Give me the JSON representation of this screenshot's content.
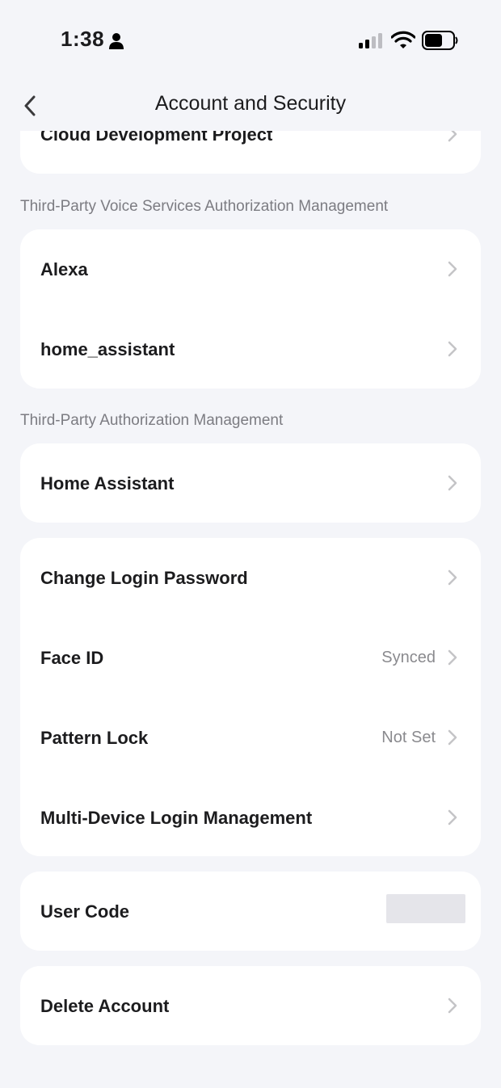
{
  "status_bar": {
    "time": "1:38",
    "icons": [
      "person-icon",
      "signal-icon",
      "wifi-icon",
      "battery-icon"
    ]
  },
  "header": {
    "title": "Account and Security",
    "back_icon": "chevron-left-icon"
  },
  "sections": {
    "top_card": {
      "items": [
        {
          "label": "Cloud Development Project"
        }
      ]
    },
    "voice_services": {
      "header": "Third-Party Voice Services Authorization Management",
      "items": [
        {
          "label": "Alexa"
        },
        {
          "label": "home_assistant"
        }
      ]
    },
    "third_party": {
      "header": "Third-Party Authorization Management",
      "items": [
        {
          "label": "Home Assistant"
        }
      ]
    },
    "security": {
      "items": [
        {
          "label": "Change Login Password",
          "value": ""
        },
        {
          "label": "Face ID",
          "value": "Synced"
        },
        {
          "label": "Pattern Lock",
          "value": "Not Set"
        },
        {
          "label": "Multi-Device Login Management",
          "value": ""
        }
      ]
    },
    "user_code": {
      "label": "User Code"
    },
    "delete_account": {
      "label": "Delete Account"
    }
  },
  "colors": {
    "background": "#F4F5F9",
    "card": "#FFFFFF",
    "primary_text": "#1C1C1E",
    "secondary_text": "#8A8A8E",
    "chevron": "#C4C4C7"
  }
}
